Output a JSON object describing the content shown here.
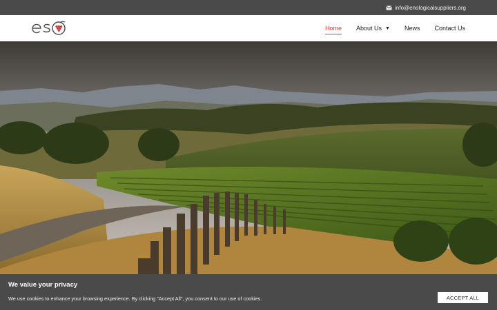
{
  "topbar": {
    "email": "info@enologicalsuppliers.org",
    "icon": "envelope-icon"
  },
  "header": {
    "logo_text": "eso",
    "nav": [
      {
        "label": "Home",
        "active": true
      },
      {
        "label": "About Us",
        "has_dropdown": true
      },
      {
        "label": "News"
      },
      {
        "label": "Contact Us"
      }
    ]
  },
  "cookie": {
    "title": "We value your privacy",
    "text": "We use cookies to enhance your browsing experience. By clicking \"Accept All\", you consent to our use of cookies.",
    "accept_label": "ACCEPT ALL"
  },
  "colors": {
    "accent": "#d43c3c",
    "bar": "#4a4a4a"
  }
}
